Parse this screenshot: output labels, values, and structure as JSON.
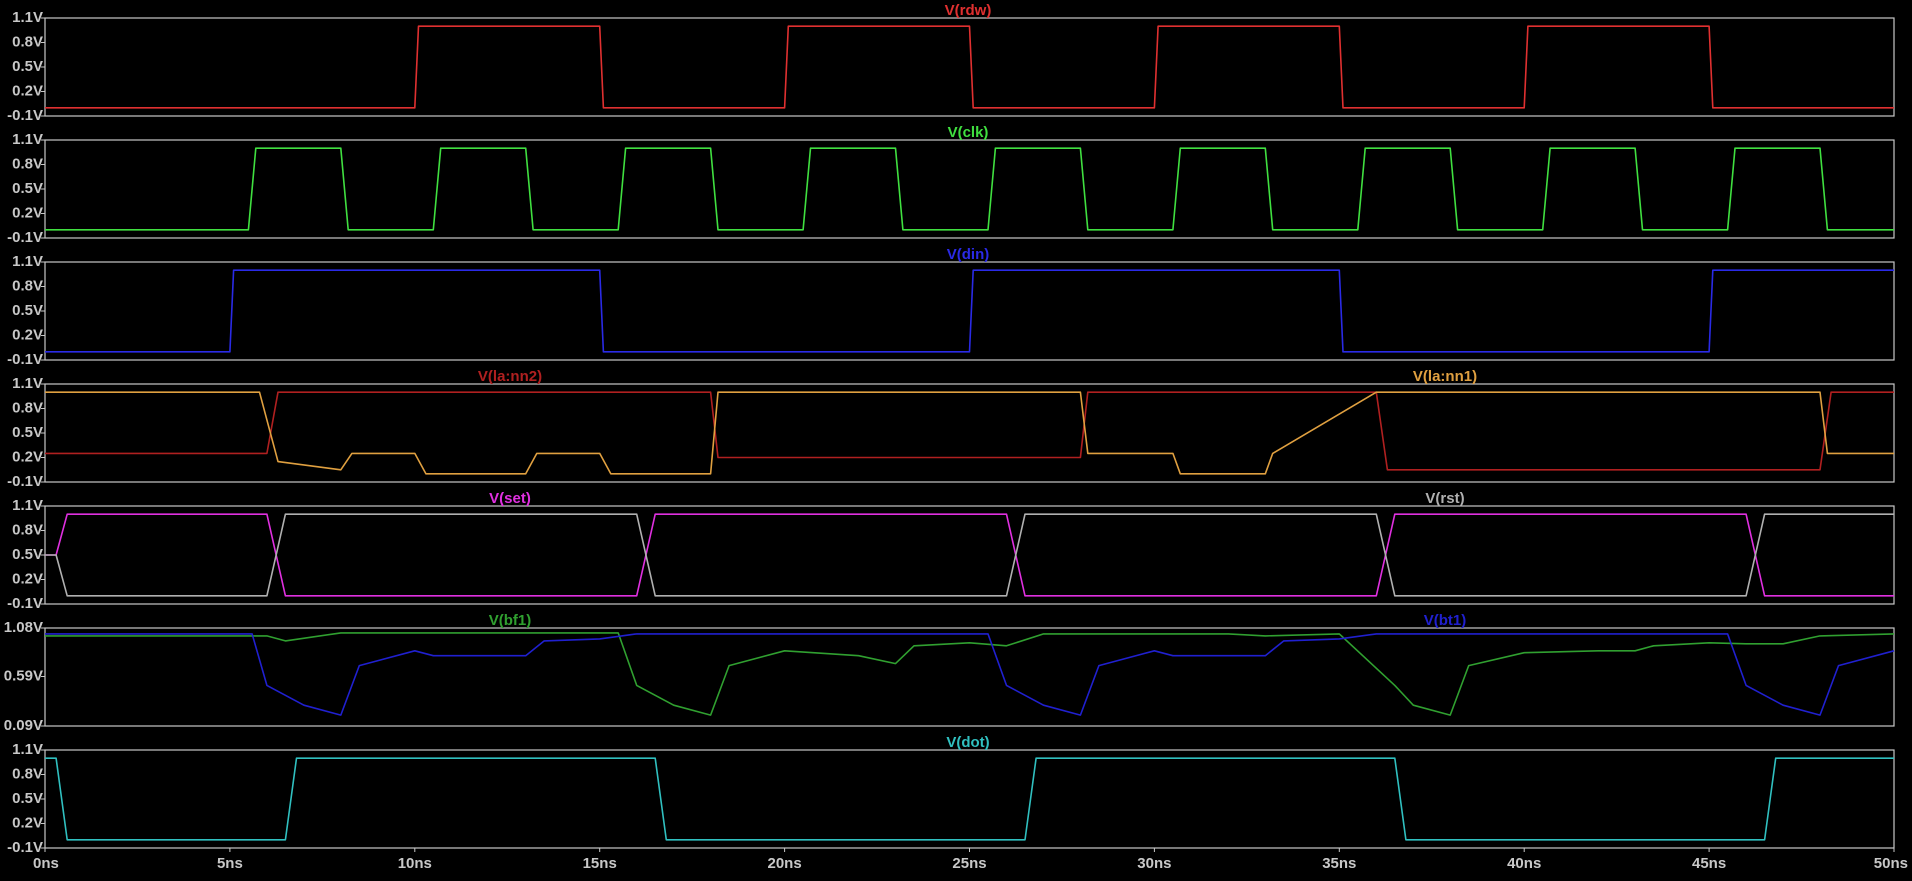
{
  "chart_data": {
    "type": "line",
    "x_unit": "ns",
    "xlim": [
      0,
      50
    ],
    "x_ticks": [
      "0ns",
      "5ns",
      "10ns",
      "15ns",
      "20ns",
      "25ns",
      "30ns",
      "35ns",
      "40ns",
      "45ns",
      "50ns"
    ],
    "x_tick_values": [
      0,
      5,
      10,
      15,
      20,
      25,
      30,
      35,
      40,
      45,
      50
    ],
    "grid": false,
    "panels": [
      {
        "ylim": [
          -0.1,
          1.1
        ],
        "y_ticks": [
          "1.1V",
          "0.8V",
          "0.5V",
          "0.2V",
          "-0.1V"
        ],
        "y_tick_values": [
          1.1,
          0.8,
          0.5,
          0.2,
          -0.1
        ],
        "series": [
          {
            "name": "V(rdw)",
            "color": "#e03030",
            "label_pos": "center",
            "x": [
              0,
              10,
              10.1,
              15,
              15.1,
              20,
              20.1,
              25,
              25.1,
              30,
              30.1,
              35,
              35.1,
              40,
              40.1,
              45,
              45.1,
              50
            ],
            "y": [
              0,
              0,
              1,
              1,
              0,
              0,
              1,
              1,
              0,
              0,
              1,
              1,
              0,
              0,
              1,
              1,
              0,
              0
            ]
          }
        ]
      },
      {
        "ylim": [
          -0.1,
          1.1
        ],
        "y_ticks": [
          "1.1V",
          "0.8V",
          "0.5V",
          "0.2V",
          "-0.1V"
        ],
        "y_tick_values": [
          1.1,
          0.8,
          0.5,
          0.2,
          -0.1
        ],
        "series": [
          {
            "name": "V(clk)",
            "color": "#40e040",
            "label_pos": "center",
            "x": [
              0,
              5.5,
              5.7,
              8,
              8.2,
              10.5,
              10.7,
              13,
              13.2,
              15.5,
              15.7,
              18,
              18.2,
              20.5,
              20.7,
              23,
              23.2,
              25.5,
              25.7,
              28,
              28.2,
              30.5,
              30.7,
              33,
              33.2,
              35.5,
              35.7,
              38,
              38.2,
              40.5,
              40.7,
              43,
              43.2,
              45.5,
              45.7,
              48,
              48.2,
              50
            ],
            "y": [
              0,
              0,
              1,
              1,
              0,
              0,
              1,
              1,
              0,
              0,
              1,
              1,
              0,
              0,
              1,
              1,
              0,
              0,
              1,
              1,
              0,
              0,
              1,
              1,
              0,
              0,
              1,
              1,
              0,
              0,
              1,
              1,
              0,
              0,
              1,
              1,
              0,
              0
            ]
          }
        ]
      },
      {
        "ylim": [
          -0.1,
          1.1
        ],
        "y_ticks": [
          "1.1V",
          "0.8V",
          "0.5V",
          "0.2V",
          "-0.1V"
        ],
        "y_tick_values": [
          1.1,
          0.8,
          0.5,
          0.2,
          -0.1
        ],
        "series": [
          {
            "name": "V(din)",
            "color": "#2a2ae6",
            "label_pos": "center",
            "x": [
              0,
              5,
              5.1,
              15,
              15.1,
              25,
              25.1,
              35,
              35.1,
              45,
              45.1,
              50
            ],
            "y": [
              0,
              0,
              1,
              1,
              0,
              0,
              1,
              1,
              0,
              0,
              1,
              1
            ]
          }
        ]
      },
      {
        "ylim": [
          -0.1,
          1.1
        ],
        "y_ticks": [
          "1.1V",
          "0.8V",
          "0.5V",
          "0.2V",
          "-0.1V"
        ],
        "y_tick_values": [
          1.1,
          0.8,
          0.5,
          0.2,
          -0.1
        ],
        "series": [
          {
            "name": "V(la:nn2)",
            "color": "#b02020",
            "label_pos": "left",
            "x": [
              0,
              6,
              6.3,
              18,
              18.2,
              28,
              28.2,
              36,
              36.3,
              48,
              48.3,
              50
            ],
            "y": [
              0.25,
              0.25,
              1,
              1,
              0.2,
              0.2,
              1,
              1,
              0.05,
              0.05,
              1,
              1
            ]
          },
          {
            "name": "V(la:nn1)",
            "color": "#e0a040",
            "label_pos": "right",
            "x": [
              0,
              5.8,
              6.3,
              8,
              8.3,
              10,
              10.3,
              13,
              13.3,
              15,
              15.3,
              18,
              18.2,
              28,
              28.2,
              30.5,
              30.7,
              33,
              33.2,
              36,
              36.3,
              48,
              48.2,
              50
            ],
            "y": [
              1,
              1,
              0.15,
              0.05,
              0.25,
              0.25,
              0,
              0,
              0.25,
              0.25,
              0,
              0,
              1,
              1,
              0.25,
              0.25,
              0,
              0,
              0.25,
              1,
              1,
              1,
              0.25,
              0.25
            ]
          }
        ]
      },
      {
        "ylim": [
          -0.1,
          1.1
        ],
        "y_ticks": [
          "1.1V",
          "0.8V",
          "0.5V",
          "0.2V",
          "-0.1V"
        ],
        "y_tick_values": [
          1.1,
          0.8,
          0.5,
          0.2,
          -0.1
        ],
        "series": [
          {
            "name": "V(set)",
            "color": "#e030e0",
            "label_pos": "left",
            "x": [
              0,
              0.3,
              0.6,
              6,
              6.5,
              16,
              16.5,
              26,
              26.5,
              36,
              36.5,
              46,
              46.5,
              50
            ],
            "y": [
              0.5,
              0.5,
              1,
              1,
              0,
              0,
              1,
              1,
              0,
              0,
              1,
              1,
              0,
              0
            ]
          },
          {
            "name": "V(rst)",
            "color": "#b0b0b0",
            "label_pos": "right",
            "x": [
              0,
              0.3,
              0.6,
              6,
              6.5,
              16,
              16.5,
              26,
              26.5,
              36,
              36.5,
              46,
              46.5,
              50
            ],
            "y": [
              0.5,
              0.5,
              0,
              0,
              1,
              1,
              0,
              0,
              1,
              1,
              0,
              0,
              1,
              1
            ]
          }
        ]
      },
      {
        "ylim": [
          0.09,
          1.08
        ],
        "y_ticks": [
          "1.08V",
          "0.59V",
          "0.09V"
        ],
        "y_tick_values": [
          1.08,
          0.59,
          0.09
        ],
        "series": [
          {
            "name": "V(bf1)",
            "color": "#30a030",
            "label_pos": "left",
            "x": [
              0,
              6,
              6.5,
              8,
              15.5,
              16,
              17,
              18,
              18.5,
              20,
              22,
              23,
              23.5,
              25,
              26,
              27,
              32,
              33,
              35,
              36.5,
              37,
              38,
              38.5,
              40,
              42,
              43,
              43.5,
              45,
              46,
              47,
              48,
              50
            ],
            "y": [
              1.0,
              1.0,
              0.95,
              1.03,
              1.03,
              0.5,
              0.3,
              0.2,
              0.7,
              0.85,
              0.8,
              0.72,
              0.9,
              0.93,
              0.9,
              1.02,
              1.02,
              1.0,
              1.02,
              0.5,
              0.3,
              0.2,
              0.7,
              0.83,
              0.85,
              0.85,
              0.9,
              0.93,
              0.92,
              0.92,
              1.0,
              1.02
            ]
          },
          {
            "name": "V(bt1)",
            "color": "#2020d0",
            "label_pos": "right",
            "x": [
              0,
              5.6,
              6,
              7,
              8,
              8.5,
              10,
              10.5,
              13,
              13.5,
              15,
              16,
              25.5,
              26,
              27,
              28,
              28.5,
              30,
              30.5,
              33,
              33.5,
              35,
              36,
              45.5,
              46,
              47,
              48,
              48.5,
              50
            ],
            "y": [
              1.02,
              1.02,
              0.5,
              0.3,
              0.2,
              0.7,
              0.85,
              0.8,
              0.8,
              0.95,
              0.97,
              1.02,
              1.02,
              0.5,
              0.3,
              0.2,
              0.7,
              0.85,
              0.8,
              0.8,
              0.95,
              0.97,
              1.02,
              1.02,
              0.5,
              0.3,
              0.2,
              0.7,
              0.85
            ]
          }
        ]
      },
      {
        "ylim": [
          -0.1,
          1.1
        ],
        "y_ticks": [
          "1.1V",
          "0.8V",
          "0.5V",
          "0.2V",
          "-0.1V"
        ],
        "y_tick_values": [
          1.1,
          0.8,
          0.5,
          0.2,
          -0.1
        ],
        "series": [
          {
            "name": "V(dot)",
            "color": "#30c0c0",
            "label_pos": "center",
            "x": [
              0,
              0.3,
              0.6,
              6.5,
              6.8,
              16.5,
              16.8,
              26.5,
              26.8,
              36.5,
              36.8,
              46.5,
              46.8,
              50
            ],
            "y": [
              1,
              1,
              0,
              0,
              1,
              1,
              0,
              0,
              1,
              1,
              0,
              0,
              1,
              1
            ]
          }
        ]
      }
    ]
  }
}
